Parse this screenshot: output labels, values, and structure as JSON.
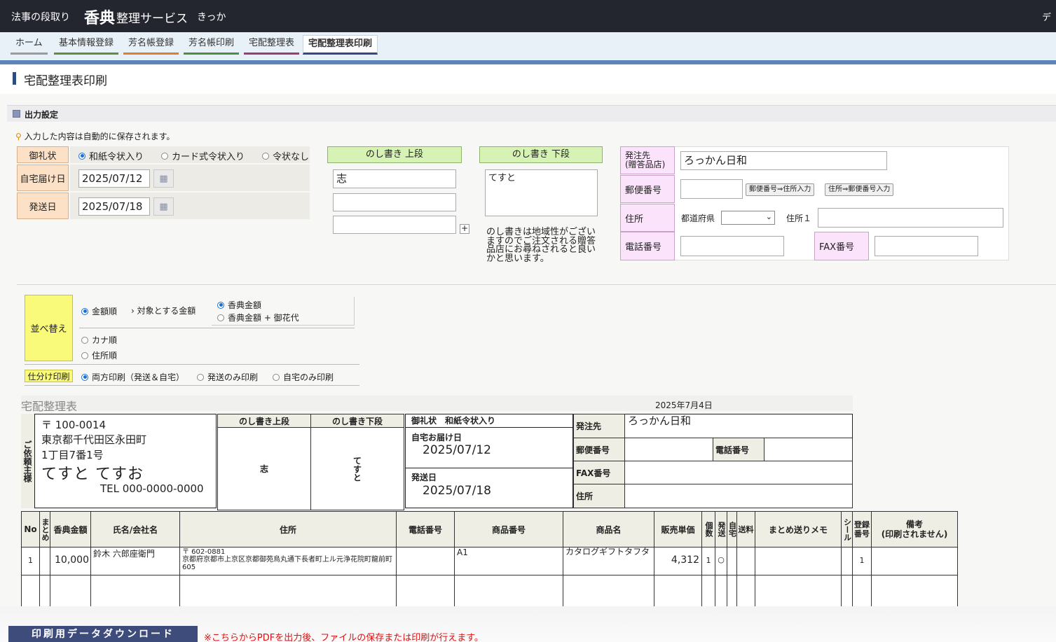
{
  "topbar": {
    "left_text": "法事の段取り",
    "logo": "香典",
    "service": "整理サービス",
    "user": "きっか",
    "right_cut": "デ"
  },
  "tabs": [
    {
      "label": "ホーム"
    },
    {
      "label": "基本情報登録"
    },
    {
      "label": "芳名帳登録"
    },
    {
      "label": "芳名帳印刷"
    },
    {
      "label": "宅配整理表"
    },
    {
      "label": "宅配整理表印刷"
    }
  ],
  "page": {
    "title": "宅配整理表印刷"
  },
  "output": {
    "section_title": "出力設定",
    "autosave_note": "入力した内容は自動的に保存されます。",
    "reijo_label": "御礼状",
    "reijo_options": [
      "和紙令状入り",
      "カード式令状入り",
      "令状なし"
    ],
    "jitaku_label": "自宅届け日",
    "jitaku_value": "2025/07/12",
    "hasso_label": "発送日",
    "hasso_value": "2025/07/18",
    "noshi_upper_label": "のし書き 上段",
    "noshi_upper_values": [
      "志",
      "",
      ""
    ],
    "noshi_lower_label": "のし書き 下段",
    "noshi_lower_value": "てすと",
    "noshi_note": "のし書きは地域性がございますのでご注文される贈答品店にお尋ねされると良いかと思います。",
    "orderer_label": "発注先\n(贈答品店)",
    "orderer_value": "ろっかん日和",
    "postal_label": "郵便番号",
    "btn_postal_to_addr": "郵便番号⇒住所入力",
    "btn_addr_to_postal": "住所⇒郵便番号入力",
    "address_label": "住所",
    "pref_label": "都道府県",
    "addr1_label": "住所１",
    "phone_label": "電話番号",
    "fax_label": "FAX番号",
    "sort_label": "並べ替え",
    "sort_options": [
      "金額順",
      "カナ順",
      "住所順"
    ],
    "target_label": "対象とする金額",
    "target_options": [
      "香典金額",
      "香典金額 + 御花代"
    ],
    "split_label": "仕分け印刷",
    "split_options": [
      "両方印刷（発送＆自宅）",
      "発送のみ印刷",
      "自宅のみ印刷"
    ]
  },
  "preview": {
    "title": "宅配整理表",
    "date": "2025年7月4日",
    "requester_label": "ご依頼主様",
    "postal": "〒 100-0014",
    "addr1": "東京都千代田区永田町",
    "addr2": "1丁目7番1号",
    "name": "てすと てすお",
    "tel": "TEL 000-0000-0000",
    "noshi_upper_h": "のし書き上段",
    "noshi_lower_h": "のし書き下段",
    "noshi_upper": "志",
    "noshi_lower": "てすと",
    "reijo_h": "御礼状　和紙令状入り",
    "jitaku_h": "自宅お届け日",
    "jitaku": "2025/07/12",
    "hasso_h": "発送日",
    "hasso": "2025/07/18",
    "orderer_h": "発注先",
    "orderer": "ろっかん日和",
    "postal_h": "郵便番号",
    "phone_h": "電話番号",
    "fax_h": "FAX番号",
    "addr_h": "住所"
  },
  "table": {
    "headers": [
      "No",
      "まとめ",
      "香典金額",
      "氏名/会社名",
      "住所",
      "電話番号",
      "商品番号",
      "商品名",
      "販売単価",
      "個数",
      "発送",
      "自宅",
      "送料",
      "まとめ送りメモ",
      "シール",
      "登録番号",
      "備考\n(印刷されません)"
    ],
    "row": {
      "no": "1",
      "amount": "10,000",
      "name": "鈴木 六郎座衛門",
      "addr_postal": "〒 602-0881",
      "addr": "京都府京都市上京区京都御苑烏丸通下長者町上ル元浄花院町龍前町605",
      "product_no": "A1",
      "product_name": "カタログギフトタフタ",
      "price": "4,312",
      "qty": "1",
      "hasso": "○",
      "reg": "1"
    }
  },
  "bottom": {
    "download": "印刷用データダウンロード",
    "note": "※こちらからPDFを出力後、ファイルの保存または印刷が行えます。"
  }
}
